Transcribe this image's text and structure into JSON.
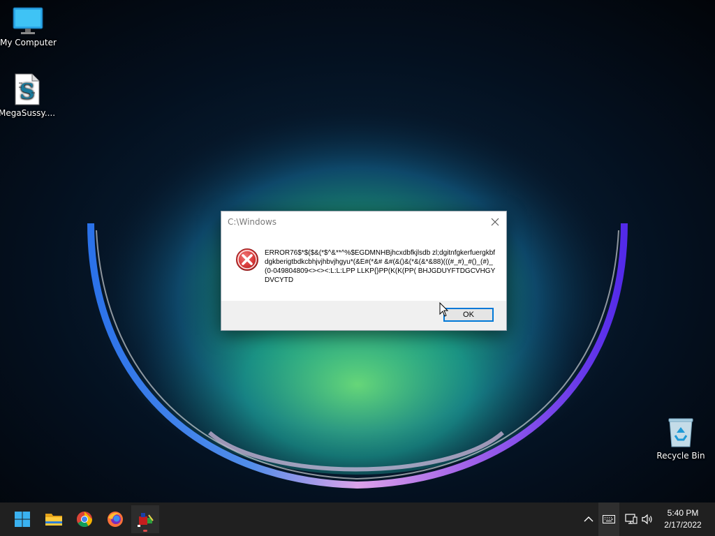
{
  "desktop": {
    "icons": [
      {
        "label": "My Computer",
        "icon": "computer-monitor-icon"
      },
      {
        "label": "MegaSussy....",
        "icon": "script-file-icon"
      },
      {
        "label": "Recycle Bin",
        "icon": "recycle-bin-icon"
      }
    ]
  },
  "dialog": {
    "title": "C:\\Windows",
    "icon": "error-icon",
    "message": "ERROR76$*$($&(*$^&**^%$EGDMNHBjhcxdbfkjlsdb zl;dgitnfgkerfuergkbfdgkberigtbdkcbhjvjhbvjhgyu*(&E#(*&# &#(&()&(*&(&*&88)(((#_#)_#()_(#)_(0-049804809<><><:L:L:LPP LLKP{}PP(K(K(PP( BHJGDUYFTDGCVHGYDVCYTD",
    "ok_label": "OK"
  },
  "taskbar": {
    "apps": [
      {
        "name": "Start",
        "icon": "windows-start-icon"
      },
      {
        "name": "File Explorer",
        "icon": "folder-icon"
      },
      {
        "name": "Google Chrome",
        "icon": "chrome-icon"
      },
      {
        "name": "Firefox",
        "icon": "firefox-icon"
      },
      {
        "name": "Running app",
        "icon": "app-icon"
      }
    ],
    "tray": {
      "icons": [
        "chevron-up-icon",
        "keyboard-icon",
        "network-icon",
        "volume-icon"
      ],
      "time": "5:40 PM",
      "date": "2/17/2022"
    }
  },
  "colors": {
    "taskbar": "#202020",
    "accent": "#0078d7",
    "error": "#d93a3a"
  }
}
